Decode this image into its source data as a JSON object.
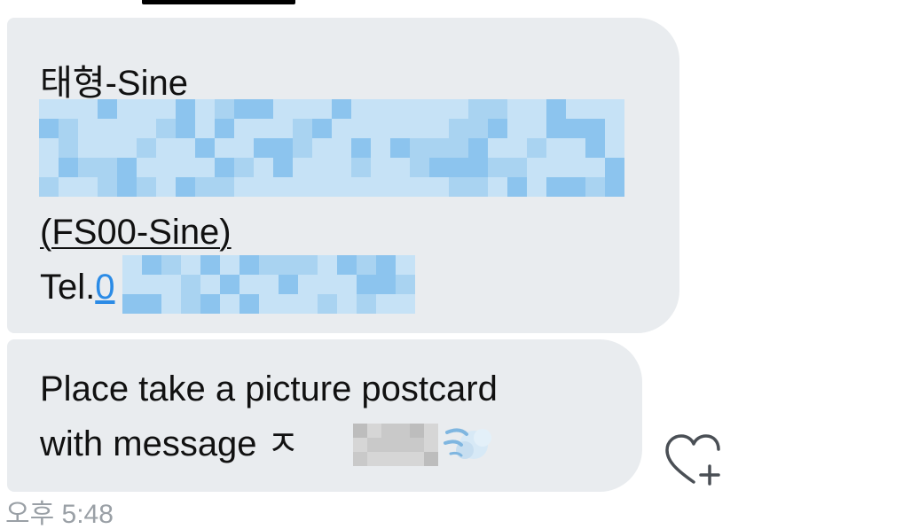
{
  "messages": [
    {
      "sender_name": "태형-Sine",
      "branch": "(FS00-Sine)",
      "tel_label": "Tel.",
      "tel_visible_digit": "0"
    },
    {
      "line1": "Place take a picture postcard",
      "line2": "with message ㅈ"
    }
  ],
  "time_text": "오후 5:48",
  "colors": {
    "bubble": "#e9ecef",
    "link": "#2b8be6",
    "blur_a": "#a9d3f1",
    "blur_b": "#c6e2f6",
    "blur_c": "#8cc4ee",
    "blur_grey": "#c9c9c9"
  },
  "icons": {
    "reaction": "heart-plus-icon",
    "emoji": "dashing-away-emoji-icon"
  }
}
